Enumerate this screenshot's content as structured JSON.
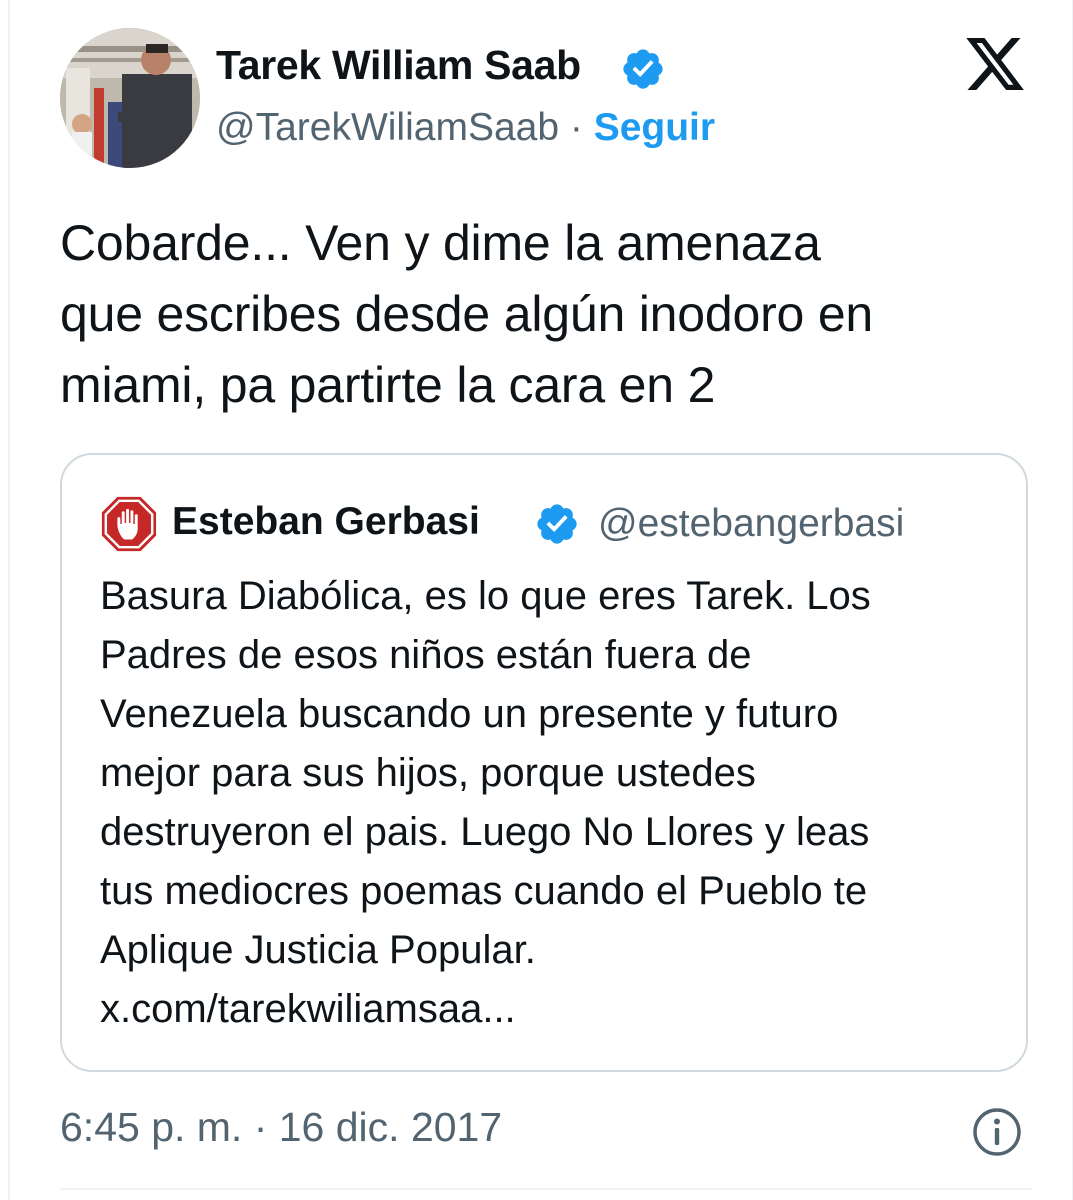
{
  "author": {
    "display_name": "Tarek William Saab",
    "handle": "@TarekWiliamSaab",
    "separator": " · ",
    "follow_label": "Seguir",
    "verified_icon": "verified-badge-icon",
    "avatar_icon": "profile-photo"
  },
  "platform": {
    "logo_icon": "x-logo-icon"
  },
  "tweet": {
    "lines": [
      "Cobarde... Ven y dime la amenaza",
      "que escribes desde algún inodoro en",
      "miami, pa partirte la cara en 2"
    ]
  },
  "quoted": {
    "display_name": "Esteban Gerbasi",
    "handle": "@estebangerbasi",
    "avatar_icon": "stop-hand-icon",
    "verified_icon": "verified-badge-icon",
    "lines": [
      "Basura Diabólica, es lo que eres Tarek. Los",
      "Padres de esos niños están fuera de",
      "Venezuela buscando un presente y futuro",
      "mejor para sus hijos, porque ustedes",
      "destruyeron el pais. Luego No Llores y leas",
      "tus mediocres poemas cuando el Pueblo te",
      "Aplique Justicia Popular."
    ],
    "link": "x.com/tarekwiliamsaa..."
  },
  "footer": {
    "timestamp": "6:45 p. m. · 16 dic. 2017",
    "info_icon": "info-icon"
  },
  "colors": {
    "text": "#0f1419",
    "secondary": "#536471",
    "accent": "#1d9bf0",
    "border": "#cfd9de"
  }
}
